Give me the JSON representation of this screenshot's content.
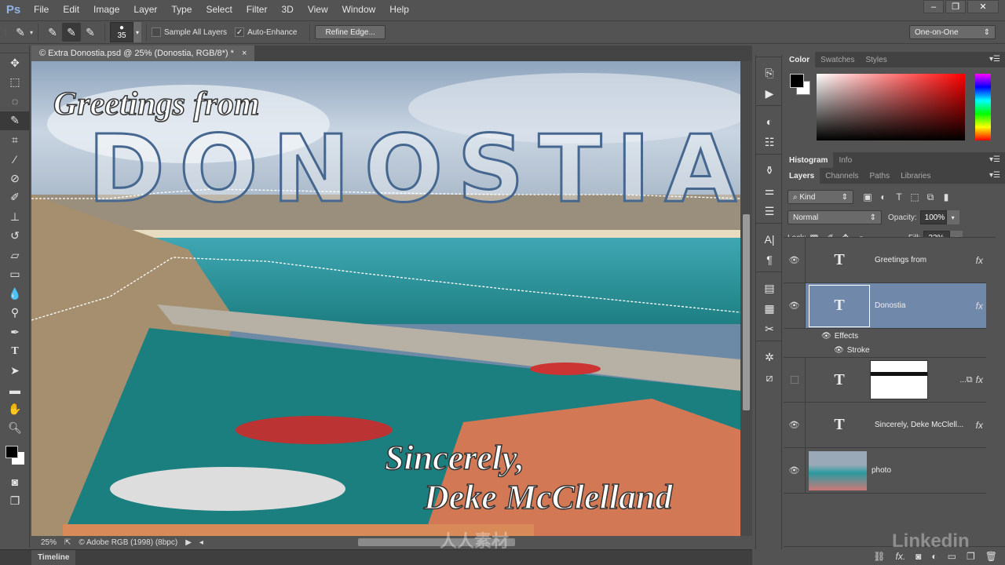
{
  "app": {
    "logo": "Ps"
  },
  "menubar": {
    "items": [
      "File",
      "Edit",
      "Image",
      "Layer",
      "Type",
      "Select",
      "Filter",
      "3D",
      "View",
      "Window",
      "Help"
    ]
  },
  "window_controls": {
    "minimize": "–",
    "restore": "❐",
    "close": "✕"
  },
  "options_bar": {
    "brush_size": "35",
    "sample_all_layers": {
      "label": "Sample All Layers",
      "checked": false
    },
    "auto_enhance": {
      "label": "Auto-Enhance",
      "checked": true
    },
    "refine_edge_label": "Refine Edge...",
    "workspace": "One-on-One"
  },
  "document": {
    "tab_title": "© Extra Donostia.psd @ 25% (Donostia, RGB/8*) *",
    "close": "×",
    "canvas_text": {
      "greeting": "Greetings from",
      "city": "DONOSTIA",
      "signoff_1": "Sincerely,",
      "signoff_2": "Deke McClelland"
    },
    "status": {
      "zoom": "25%",
      "profile": "© Adobe RGB (1998) (8bpc)"
    }
  },
  "timeline": {
    "label": "Timeline"
  },
  "toolbox": {
    "tools": [
      "move",
      "marquee",
      "lasso",
      "quick-selection",
      "crop",
      "eyedropper",
      "healing",
      "brush",
      "clone-stamp",
      "history-brush",
      "eraser",
      "gradient",
      "blur",
      "dodge",
      "pen",
      "type",
      "path-selection",
      "rectangle",
      "hand",
      "zoom"
    ],
    "active": "quick-selection"
  },
  "panels": {
    "color_tabs": [
      "Color",
      "Swatches",
      "Styles"
    ],
    "histogram_tabs": [
      "Histogram",
      "Info"
    ],
    "layers_tabs": [
      "Layers",
      "Channels",
      "Paths",
      "Libraries"
    ],
    "filter_kind": "Kind",
    "blend_mode": "Normal",
    "opacity_label": "Opacity:",
    "opacity": "100%",
    "lock_label": "Lock:",
    "fill_label": "Fill:",
    "fill": "33%"
  },
  "layers": [
    {
      "name": "Greetings from",
      "type": "text",
      "visible": true,
      "fx": true,
      "selected": false
    },
    {
      "name": "Donostia",
      "type": "text",
      "visible": true,
      "fx": true,
      "selected": true,
      "effects": [
        "Effects",
        "Stroke"
      ]
    },
    {
      "name": "...",
      "type": "text-with-mask",
      "visible": false,
      "fx": true,
      "selected": false
    },
    {
      "name": "Sincerely,     Deke McClell...",
      "type": "text",
      "visible": true,
      "fx": true,
      "selected": false
    },
    {
      "name": "photo",
      "type": "image",
      "visible": true,
      "fx": false,
      "selected": false
    }
  ],
  "watermark": {
    "brand": "Linkedin",
    "site": "人人素材"
  }
}
